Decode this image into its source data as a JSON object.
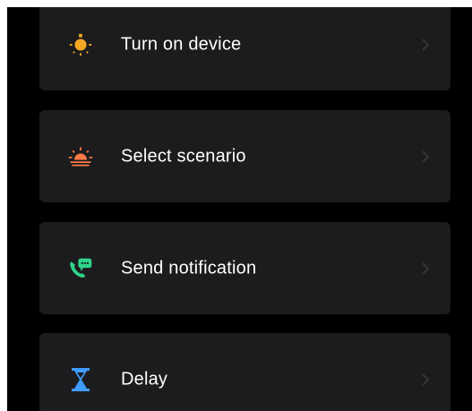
{
  "actions": [
    {
      "label": "Turn on device",
      "icon": "lightbulb-icon",
      "color": "#f5a623"
    },
    {
      "label": "Select scenario",
      "icon": "sunrise-icon",
      "color": "#ff7a45"
    },
    {
      "label": "Send notification",
      "icon": "message-phone-icon",
      "color": "#2fd58a"
    },
    {
      "label": "Delay",
      "icon": "hourglass-icon",
      "color": "#3f9bff"
    }
  ],
  "colors": {
    "background": "#000000",
    "card": "#1c1c1e",
    "text": "#ffffff",
    "chevron": "#3a3a3c"
  }
}
